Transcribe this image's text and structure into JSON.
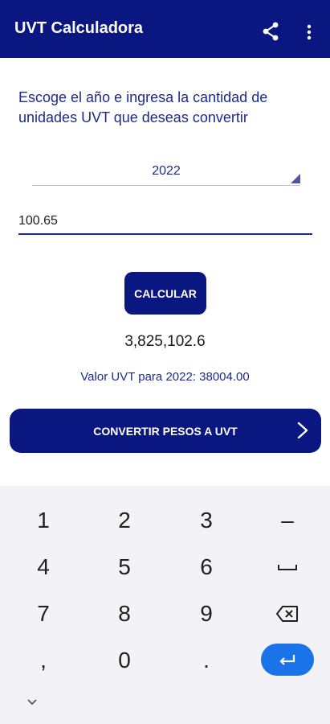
{
  "app_bar": {
    "title": "UVT Calculadora",
    "background_color": "#0b1780",
    "icons": [
      "share-icon",
      "more-vert-icon"
    ]
  },
  "form": {
    "instructions": "Escoge el año e ingresa la cantidad de unidades UVT que deseas convertir",
    "year_selected": "2022",
    "amount_value": "100.65",
    "calculate_label": "CALCULAR"
  },
  "result": {
    "value": "3,825,102.6",
    "uvt_info": "Valor UVT para 2022: 38004.00"
  },
  "convert_button": {
    "label": "CONVERTIR PESOS A UVT",
    "icon": "chevron-right-icon"
  },
  "keyboard": {
    "keys": {
      "k1": "1",
      "k2": "2",
      "k3": "3",
      "minus": "–",
      "k4": "4",
      "k5": "5",
      "k6": "6",
      "k7": "7",
      "k8": "8",
      "k9": "9",
      "comma": ",",
      "k0": "0",
      "dot": "."
    },
    "icons": [
      "space-icon",
      "backspace-icon",
      "enter-icon",
      "chevron-down-icon"
    ],
    "accent_color": "#1a73e8"
  }
}
